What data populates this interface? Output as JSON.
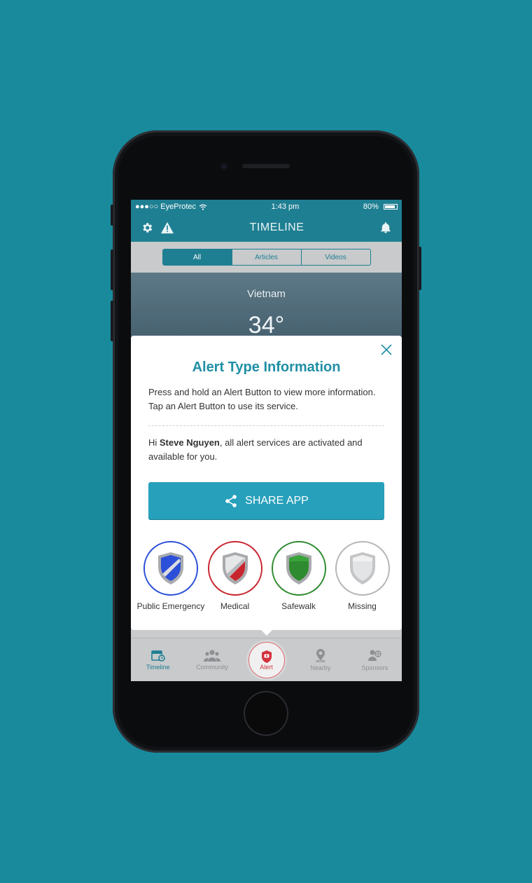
{
  "colors": {
    "background": "#188a9c",
    "brand": "#1f7f92",
    "title_teal": "#1f8fa4",
    "share_button": "#27a0bb",
    "alert_red": "#d2323d"
  },
  "statusbar": {
    "carrier": "●●●○○ EyeProtec",
    "time": "1:43 pm",
    "battery": "80%"
  },
  "navbar": {
    "title": "TIMELINE",
    "left_icons": [
      "gear-icon",
      "warning-icon"
    ],
    "right_icon": "bell-icon"
  },
  "segments": [
    {
      "label": "All",
      "active": true
    },
    {
      "label": "Articles",
      "active": false
    },
    {
      "label": "Videos",
      "active": false
    }
  ],
  "weather": {
    "city": "Vietnam",
    "temperature": "34°"
  },
  "modal": {
    "title": "Alert Type Information",
    "intro": "Press and hold an Alert Button to view more information. Tap an Alert Button to use its service.",
    "greeting_prefix": "Hi ",
    "user_name": "Steve Nguyen",
    "greeting_suffix": ", all alert services are activated and available for you.",
    "share_label": "SHARE APP",
    "alert_types": [
      {
        "label": "Public Emergency",
        "color": "#2b4fd8"
      },
      {
        "label": "Medical",
        "color": "#c8262f"
      },
      {
        "label": "Safewalk",
        "color": "#2f8b2f"
      },
      {
        "label": "Missing",
        "color": "#b5b5b5"
      }
    ]
  },
  "tabbar": [
    {
      "label": "Timeline",
      "icon": "calendar-icon",
      "active": true
    },
    {
      "label": "Community",
      "icon": "people-icon",
      "active": false
    },
    {
      "label": "Alert",
      "icon": "alert-shield-icon",
      "active": false
    },
    {
      "label": "Nearby",
      "icon": "location-pin-icon",
      "active": false
    },
    {
      "label": "Sponsors",
      "icon": "sponsors-icon",
      "active": false
    }
  ]
}
